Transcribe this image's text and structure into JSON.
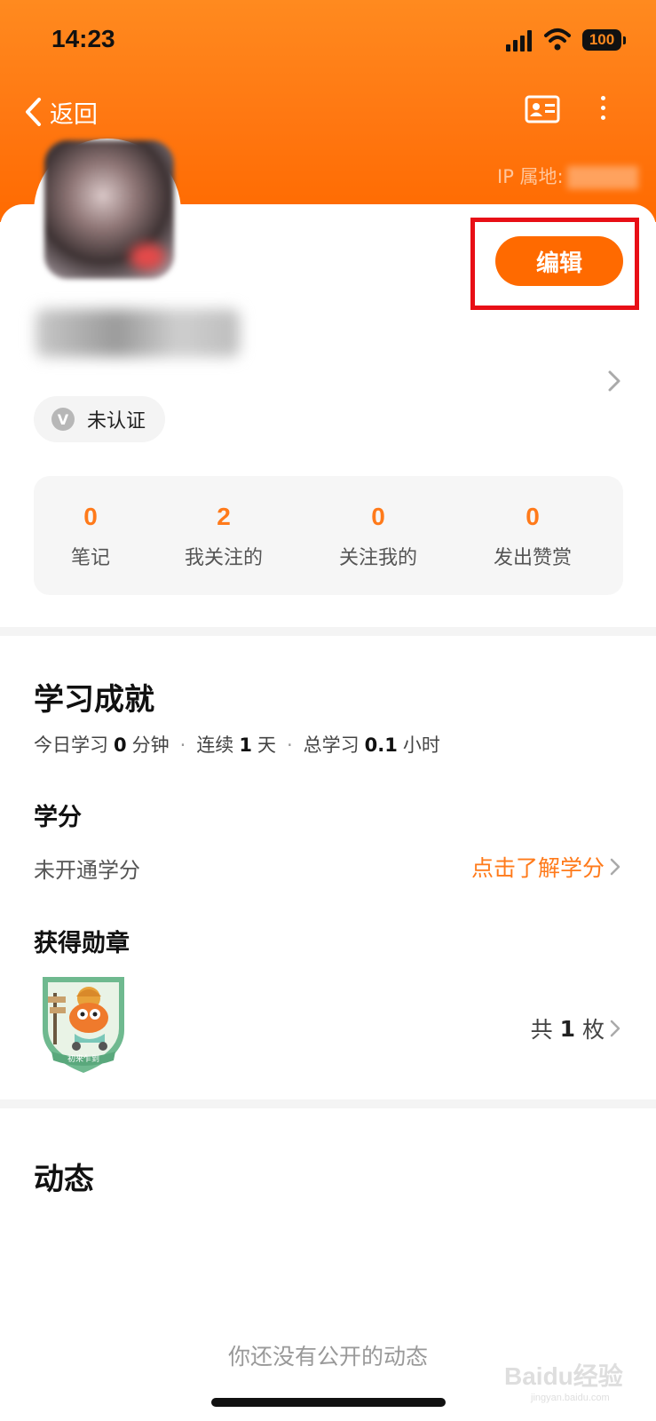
{
  "status_bar": {
    "time": "14:23",
    "battery": "100"
  },
  "nav": {
    "back_label": "返回",
    "ip_label": "IP 属地:"
  },
  "profile": {
    "edit_label": "编辑",
    "verify_label": "未认证",
    "verify_icon_letter": "V"
  },
  "stats": [
    {
      "value": "0",
      "label": "笔记"
    },
    {
      "value": "2",
      "label": "我关注的"
    },
    {
      "value": "0",
      "label": "关注我的"
    },
    {
      "value": "0",
      "label": "发出赞赏"
    }
  ],
  "achievements": {
    "title": "学习成就",
    "today_prefix": "今日学习",
    "today_value": "0",
    "today_unit": "分钟",
    "streak_prefix": "连续",
    "streak_value": "1",
    "streak_unit": "天",
    "total_prefix": "总学习",
    "total_value": "0.1",
    "total_unit": "小时",
    "credits_title": "学分",
    "credits_status": "未开通学分",
    "credits_link": "点击了解学分",
    "medals_title": "获得勋章",
    "medal_name": "初来乍到",
    "medal_count_prefix": "共",
    "medal_count": "1",
    "medal_count_unit": "枚"
  },
  "feed": {
    "title": "动态",
    "empty_text": "你还没有公开的动态"
  },
  "watermark": {
    "brand": "Baidu经验",
    "url": "jingyan.baidu.com"
  },
  "colors": {
    "accent": "#ff6a00",
    "highlight_box": "#e80f16"
  }
}
